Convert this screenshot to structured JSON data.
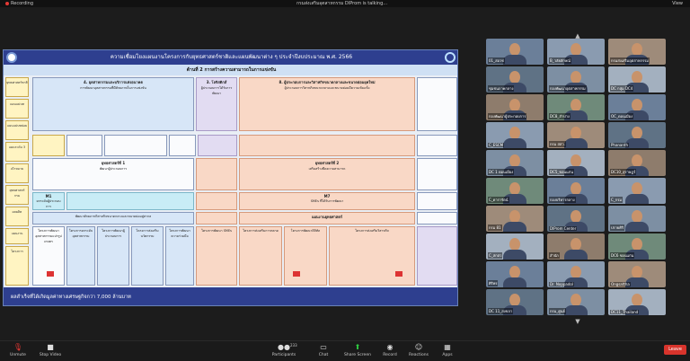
{
  "topbar": {
    "recording_label": "Recording",
    "window_title": "กรมส่งเสริมอุตสาหกรรม DIProm is talking...",
    "view_label": "View"
  },
  "slide": {
    "title": "ความเชื่อมโยงแผนงานโครงการกับยุทธศาสตร์ชาติและแผนพัฒนาต่าง ๆ ประจำปีงบประมาณ พ.ศ. 2566",
    "subtitle": "ด้านที่ 2 การสร้างความสามารถในการแข่งขัน",
    "footer": "ผลสำเร็จที่ได้เกิดมูลค่าทางเศรษฐกิจกว่า 7,000 ล้านบาท",
    "left_labels": [
      "ยุทธศาสตร์ชาติ",
      "แผนแม่บท",
      "แผนแม่บทย่อย",
      "แผนระดับ 3",
      "เป้าหมาย",
      "ยุทธศาสตร์ กรม",
      "ผลผลิต",
      "แผนงาน",
      "โครงการ"
    ],
    "top_boxes": [
      {
        "head": "4. อุตสาหกรรมและบริการแห่งอนาคต",
        "text": "การพัฒนาอุตสาหกรรมที่มีศักยภาพในการแข่งขัน"
      },
      {
        "head": "3. โลจิสติกส์",
        "text": "ผู้ประกอบการได้รับการพัฒนา"
      },
      {
        "head": "8. ผู้ประกอบการและวิสาหกิจขนาดกลางและขนาดย่อมยุคใหม่",
        "text": "ผู้ประกอบการวิสาหกิจขนาดกลางและขนาดย่อมมีความเข้มแข็ง"
      }
    ],
    "mid_boxes": [
      {
        "head": "ยุทธศาสตร์ที่ 1",
        "text": "พัฒนาผู้ประกอบการ"
      },
      {
        "head": "ยุทธศาสตร์ที่ 2",
        "text": "เสริมสร้างขีดความสามารถ"
      },
      {
        "head": "M1",
        "text": "ยกระดับผู้ประกอบการ"
      },
      {
        "head": "M7",
        "text": "SMEs ที่ได้รับการพัฒนา"
      },
      {
        "head": "แผนงานยุทธศาสตร์",
        "text": "พัฒนาศักยภาพวิสาหกิจขนาดกลางและขนาดย่อมสู่สากล"
      }
    ],
    "projects": [
      "โครงการพัฒนาอุตสาหกรรมแปรรูปเกษตร",
      "โครงการยกระดับอุตสาหกรรม",
      "โครงการพัฒนาผู้ประกอบการ",
      "โครงการส่งเสริมนวัตกรรม",
      "โครงการพัฒนาความร่วมมือ",
      "โครงการพัฒนา SMEs",
      "โครงการส่งเสริมการตลาด",
      "โครงการพัฒนาดิจิทัล",
      "โครงการส่งเสริมวิสาหกิจ"
    ]
  },
  "gallery": {
    "tiles": [
      {
        "name": "01_สอวช"
      },
      {
        "name": "B_วลัยลักษณ์"
      },
      {
        "name": "กรมส่งเสริมอุตสาหกรรม"
      },
      {
        "name": "ชุมชนภาคกลาง"
      },
      {
        "name": "กองพัฒนาอุตสาหกรรม"
      },
      {
        "name": "DC กลุ่ม DC4"
      },
      {
        "name": "กองพัฒนาผู้ประกอบการ"
      },
      {
        "name": "DC8_ลำปาง"
      },
      {
        "name": "OC_ดอนเมือง"
      },
      {
        "name": "C_ESCM"
      },
      {
        "name": "กรม สสว."
      },
      {
        "name": "Phananth"
      },
      {
        "name": "DC 1 ดอนเมือง"
      },
      {
        "name": "DC5_ขอนแก่น"
      },
      {
        "name": "DC10_สุราษฎร์"
      },
      {
        "name": "C_ดารารัตน์"
      },
      {
        "name": "กองบริหารกลาง"
      },
      {
        "name": "C_กรม"
      },
      {
        "name": "กรม 81"
      },
      {
        "name": "DIProm Center"
      },
      {
        "name": "ปรายศิริ"
      },
      {
        "name": "C_สกสว"
      },
      {
        "name": "สำนัก"
      },
      {
        "name": "DC6 ขอนแก่น"
      },
      {
        "name": "ศิริพร"
      },
      {
        "name": "Dr. Noppadol"
      },
      {
        "name": "Ongsattha"
      },
      {
        "name": "DC 11_สงขลา"
      },
      {
        "name": "กรม_ศูนย์"
      },
      {
        "name": "DC11_Thailand"
      }
    ]
  },
  "toolbar": {
    "unmute": "Unmute",
    "stop_video": "Stop Video",
    "participants": "Participants",
    "participant_count": "233",
    "chat": "Chat",
    "share_screen": "Share Screen",
    "record": "Record",
    "reactions": "Reactions",
    "apps": "Apps",
    "leave": "Leave"
  },
  "colors": {
    "slide_header": "#2e3f8f",
    "leave_button": "#d8342c",
    "share_icon": "#2ecc40"
  }
}
